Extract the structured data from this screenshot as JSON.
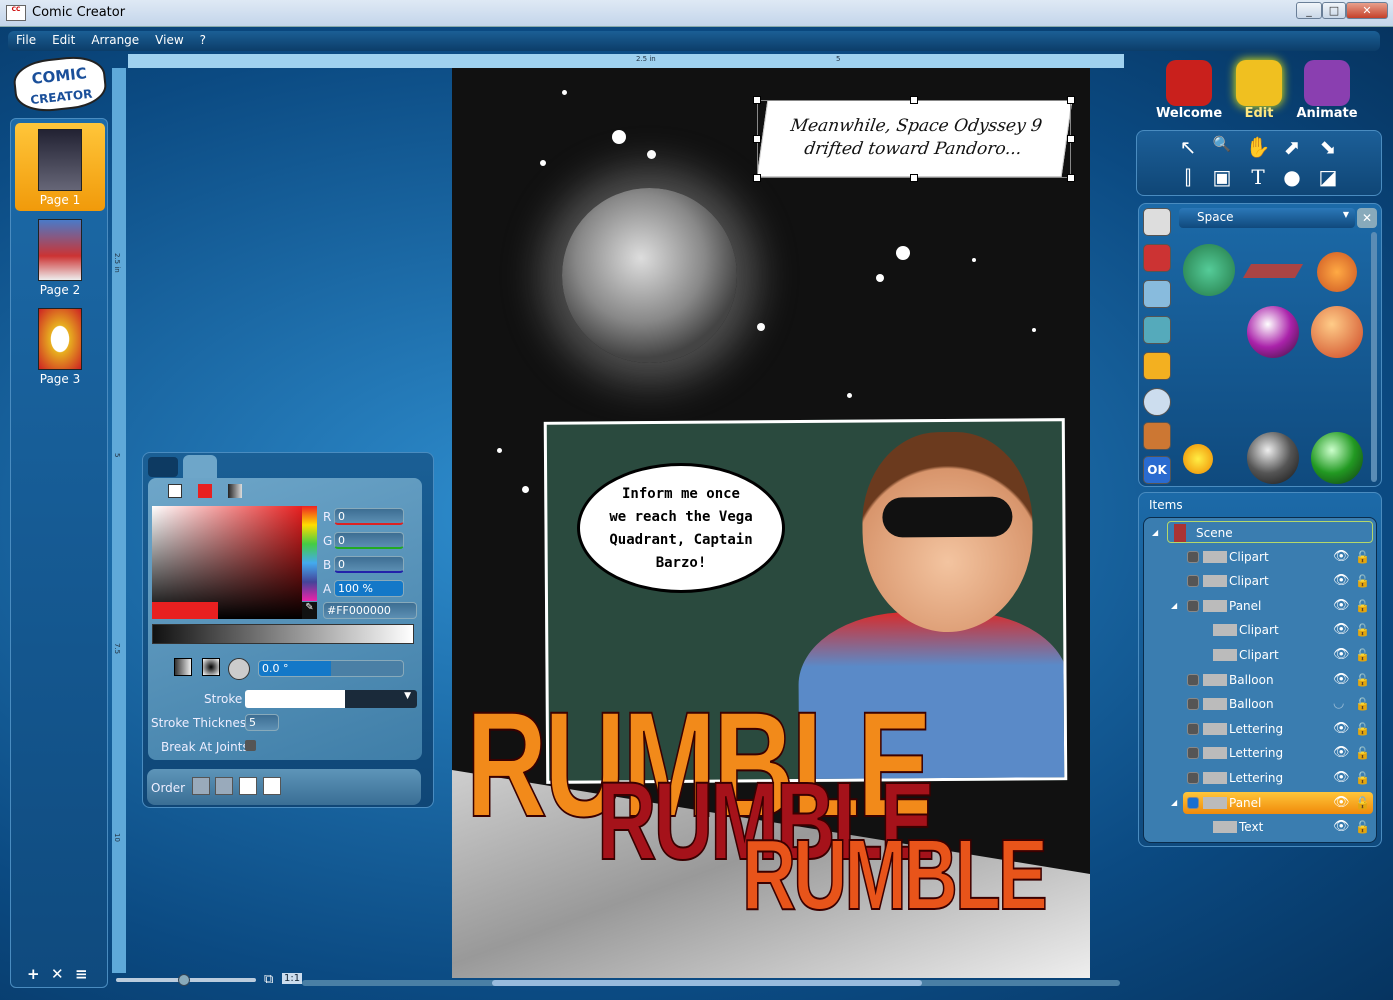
{
  "window": {
    "title": "Comic Creator",
    "logo_text": "COMIC CREATOR",
    "controls": [
      "_",
      "□",
      "✕"
    ]
  },
  "menu": [
    "File",
    "Edit",
    "Arrange",
    "View",
    "?"
  ],
  "rulers": {
    "h": [
      "2.5 in",
      "5"
    ],
    "v": [
      "2.5 in",
      "5",
      "7.5",
      "10"
    ]
  },
  "pages": [
    {
      "label": "Page 1",
      "selected": true
    },
    {
      "label": "Page 2"
    },
    {
      "label": "Page 3"
    }
  ],
  "page_buttons": [
    "+",
    "✕",
    "≡"
  ],
  "modes": [
    {
      "label": "Welcome",
      "color": "#c9201c"
    },
    {
      "label": "Edit",
      "color": "#f0c020",
      "active": true
    },
    {
      "label": "Animate",
      "color": "#8a3fb0"
    }
  ],
  "tools": [
    "↖",
    "🔍",
    "✋",
    "⬈",
    "⬊",
    "⫿",
    "▣",
    "T",
    "●",
    "◪"
  ],
  "library": {
    "category": "Space",
    "close": "✕"
  },
  "items": {
    "title": "Items",
    "rows": [
      {
        "label": "Scene",
        "level": 0,
        "expanded": true
      },
      {
        "label": "Clipart",
        "level": 1
      },
      {
        "label": "Clipart",
        "level": 1
      },
      {
        "label": "Panel",
        "level": 1,
        "expanded": true
      },
      {
        "label": "Clipart",
        "level": 2
      },
      {
        "label": "Clipart",
        "level": 2
      },
      {
        "label": "Balloon",
        "level": 1
      },
      {
        "label": "Balloon",
        "level": 1,
        "hidden": true
      },
      {
        "label": "Lettering",
        "level": 1
      },
      {
        "label": "Lettering",
        "level": 1
      },
      {
        "label": "Lettering",
        "level": 1
      },
      {
        "label": "Panel",
        "level": 1,
        "selected": true,
        "expanded": true
      },
      {
        "label": "Text",
        "level": 2
      }
    ]
  },
  "color": {
    "r_label": "R",
    "r": "0",
    "g_label": "G",
    "g": "0",
    "b_label": "B",
    "b": "0",
    "a_label": "A",
    "a": "100 %",
    "a_fraction": 1.0,
    "hex": "#FF000000",
    "angle": "0.0 °",
    "stroke_label": "Stroke",
    "stroke_thickness_label": "Stroke Thickness",
    "stroke_thickness": "5",
    "break_label": "Break At Joints",
    "order_label": "Order",
    "fill": "#e82020"
  },
  "comic": {
    "caption": [
      "Meanwhile, Space Odyssey 9",
      "drifted toward Pandoro..."
    ],
    "balloon": [
      "Inform me once",
      "we reach the Vega",
      "Quadrant, Captain",
      "Barzo!"
    ],
    "lettering": [
      "RUMBLE",
      "RUMBLE",
      "RUMBLE"
    ]
  },
  "zoom": {
    "fit_label": "⧉",
    "one_to_one": "1:1",
    "level": 0.55
  }
}
